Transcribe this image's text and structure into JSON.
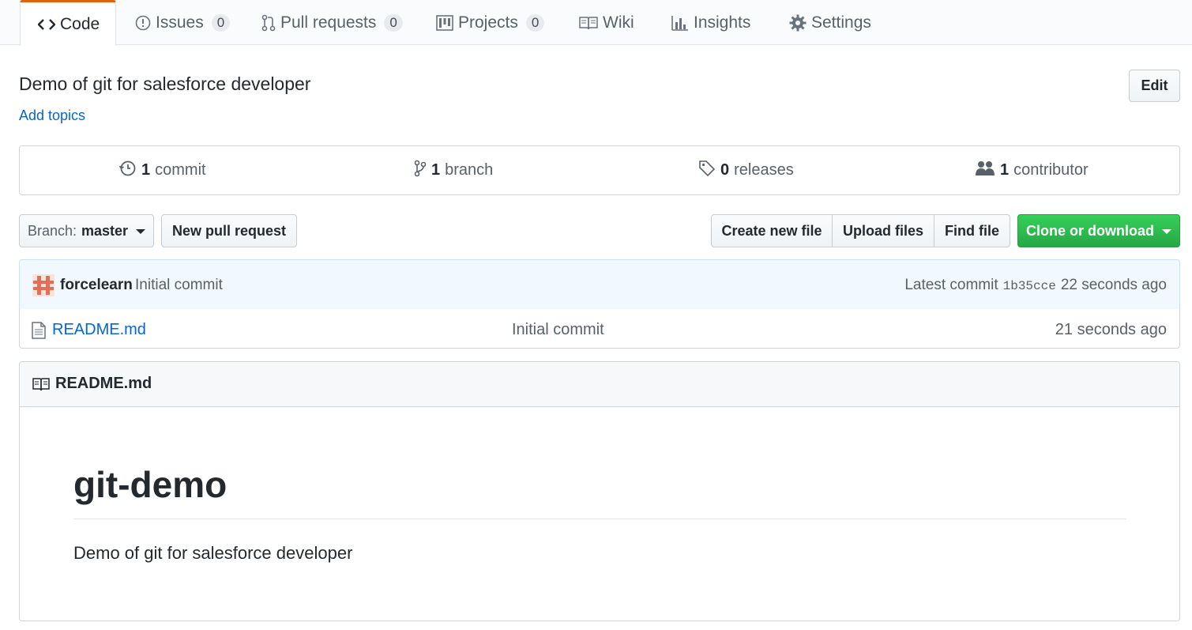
{
  "tabs": {
    "code": {
      "label": "Code",
      "icon": "code-icon"
    },
    "issues": {
      "label": "Issues",
      "count": "0",
      "icon": "issue-opened-icon"
    },
    "pulls": {
      "label": "Pull requests",
      "count": "0",
      "icon": "git-pull-request-icon"
    },
    "projects": {
      "label": "Projects",
      "count": "0",
      "icon": "project-icon"
    },
    "wiki": {
      "label": "Wiki",
      "icon": "book-icon"
    },
    "insights": {
      "label": "Insights",
      "icon": "graph-icon"
    },
    "settings": {
      "label": "Settings",
      "icon": "gear-icon"
    }
  },
  "repo": {
    "description": "Demo of git for salesforce developer",
    "add_topics": "Add topics",
    "edit_label": "Edit"
  },
  "summary": {
    "commits": {
      "count": "1",
      "label": "commit"
    },
    "branches": {
      "count": "1",
      "label": "branch"
    },
    "releases": {
      "count": "0",
      "label": "releases"
    },
    "contributors": {
      "count": "1",
      "label": "contributor"
    }
  },
  "toolbar": {
    "branch_prefix": "Branch:",
    "branch_name": "master",
    "new_pull_request": "New pull request",
    "create_new_file": "Create new file",
    "upload_files": "Upload files",
    "find_file": "Find file",
    "clone_or_download": "Clone or download"
  },
  "latest_commit": {
    "author": "forcelearn",
    "message": "Initial commit",
    "prefix": "Latest commit",
    "sha": "1b35cce",
    "age": "22 seconds ago"
  },
  "files": [
    {
      "name": "README.md",
      "commit_message": "Initial commit",
      "age": "21 seconds ago"
    }
  ],
  "readme": {
    "header": "README.md",
    "heading": "git-demo",
    "paragraph": "Demo of git for salesforce developer"
  },
  "colors": {
    "accent_tab": "#e36209",
    "link": "#0366d6",
    "primary_button": "#28a745",
    "commit_bar": "#f1f8ff"
  }
}
